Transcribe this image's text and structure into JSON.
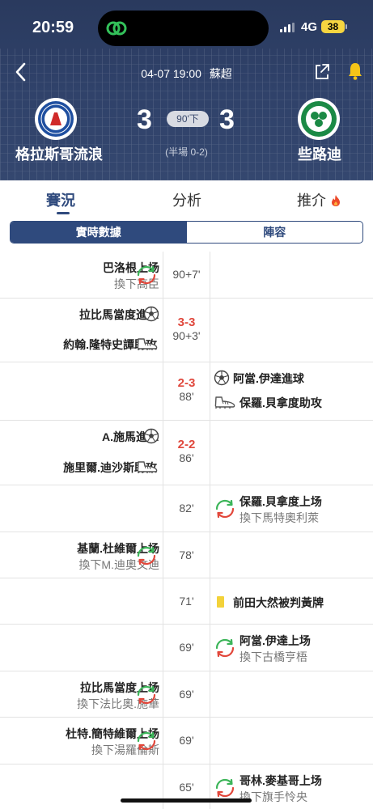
{
  "status_bar": {
    "time": "20:59",
    "network": "4G",
    "battery": "38"
  },
  "header": {
    "date_time": "04-07 19:00",
    "league": "蘇超",
    "home": {
      "name": "格拉斯哥流浪",
      "score": "3"
    },
    "away": {
      "name": "些路迪",
      "score": "3"
    },
    "minute": "90'下",
    "halftime": "(半場 0-2)",
    "colors": {
      "bg": "#2f4169",
      "pill": "#d8dbe2"
    }
  },
  "tabs": [
    {
      "label": "賽況",
      "active": true
    },
    {
      "label": "分析",
      "active": false
    },
    {
      "label": "推介",
      "active": false
    }
  ],
  "segments": [
    {
      "label": "實時數據",
      "active": true
    },
    {
      "label": "陣容",
      "active": false
    }
  ],
  "events": [
    {
      "side": "home",
      "type": "sub",
      "line1": "巴洛根上场",
      "line2": "換下高臣",
      "minute": "90+7'",
      "score": ""
    },
    {
      "side": "home",
      "type": "goal",
      "line1": "拉比馬當度進球",
      "line2": "約翰.隆特史譚助攻",
      "minute": "90+3'",
      "score": "3-3"
    },
    {
      "side": "away",
      "type": "goal",
      "line1": "阿當.伊達進球",
      "line2": "保羅.貝拿度助攻",
      "minute": "88'",
      "score": "2-3"
    },
    {
      "side": "home",
      "type": "goal",
      "line1": "A.施馬進球",
      "line2": "施里爾.迪沙斯助攻",
      "minute": "86'",
      "score": "2-2"
    },
    {
      "side": "away",
      "type": "sub",
      "line1": "保羅.貝拿度上场",
      "line2": "換下馬特奧利萊",
      "minute": "82'",
      "score": ""
    },
    {
      "side": "home",
      "type": "sub",
      "line1": "基蘭.杜維爾上场",
      "line2": "換下M.迪奧文迪",
      "minute": "78'",
      "score": ""
    },
    {
      "side": "away",
      "type": "yellow",
      "line1": "前田大然被判黃牌",
      "line2": "",
      "minute": "71'",
      "score": ""
    },
    {
      "side": "away",
      "type": "sub",
      "line1": "阿當.伊達上场",
      "line2": "換下古橋亨梧",
      "minute": "69'",
      "score": ""
    },
    {
      "side": "home",
      "type": "sub",
      "line1": "拉比馬當度上场",
      "line2": "換下法比奧.施華",
      "minute": "69'",
      "score": ""
    },
    {
      "side": "home",
      "type": "sub",
      "line1": "杜特.簡特維爾上场",
      "line2": "換下湯羅倫斯",
      "minute": "69'",
      "score": ""
    },
    {
      "side": "away",
      "type": "sub",
      "line1": "哥林.麥基哥上场",
      "line2": "換下旗手怜央",
      "minute": "65'",
      "score": ""
    }
  ]
}
